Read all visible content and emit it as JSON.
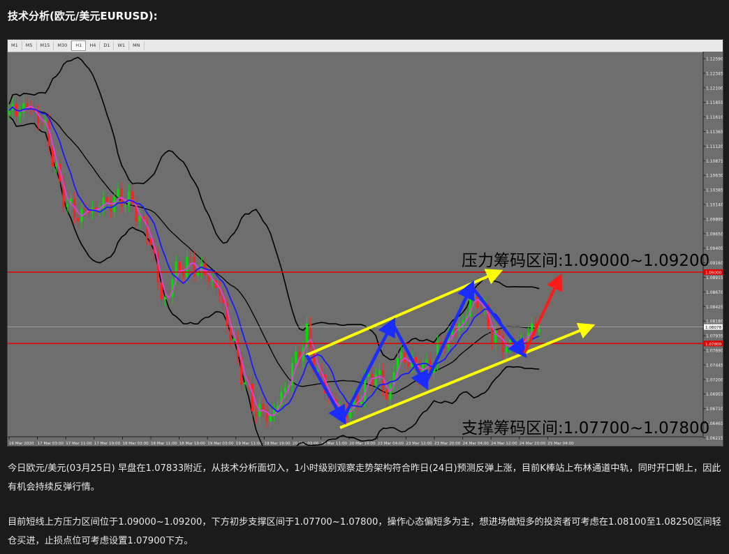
{
  "page": {
    "title": "技术分析(欧元/美元EURUSD):"
  },
  "toolbar": {
    "timeframes": [
      "M1",
      "M5",
      "M15",
      "M30",
      "H1",
      "H4",
      "D1",
      "W1",
      "MN"
    ],
    "active": "H1"
  },
  "chart": {
    "colors": {
      "background": "#6e6e6e",
      "bollinger": "#000000",
      "ma_fast": "#e040e0",
      "ma_slow": "#1a1aff",
      "candle_up": "#00e000",
      "candle_down": "#ff2020",
      "level_line": "#e00000",
      "channel": "#ffff00",
      "zigzag": "#1a2cff",
      "breakout_arrow": "#ff1a1a"
    },
    "y_ticks": [
      "1.12590",
      "1.12345",
      "1.12100",
      "1.11855",
      "1.11610",
      "1.11365",
      "1.11120",
      "1.10875",
      "1.10630",
      "1.10385",
      "1.10140",
      "1.09895",
      "1.09650",
      "1.09405",
      "1.09160",
      "1.08915",
      "1.08670",
      "1.08425",
      "1.08180",
      "1.07935",
      "1.07690",
      "1.07445",
      "1.07200",
      "1.06955",
      "1.06710",
      "1.06465",
      "1.06215"
    ],
    "current_price": "1.08078",
    "resistance_price": "1.09000",
    "support_price": "1.07800",
    "x_ticks": [
      "16 Mar 2020",
      "17 Mar 03:00",
      "17 Mar 11:00",
      "17 Mar 19:00",
      "18 Mar 03:00",
      "18 Mar 11:00",
      "18 Mar 19:00",
      "19 Mar 03:00",
      "19 Mar 11:00",
      "19 Mar 19:00",
      "20 Mar 03:00",
      "20 Mar 11:00",
      "20 Mar 19:00",
      "23 Mar 04:00",
      "23 Mar 12:00",
      "23 Mar 20:00",
      "24 Mar 04:00",
      "24 Mar 12:00",
      "24 Mar 20:00",
      "25 Mar 04:00"
    ],
    "resistance_label": "压力筹码区间:1.09000~1.09200",
    "support_label": "支撑筹码区间:1.07700~1.07800"
  },
  "text": {
    "para1": "今日欧元/美元(03月25日) 早盘在1.07833附近，从技术分析面切入，1小时级别观察走势架构符合昨日(24日)预测反弹上涨，目前K棒站上布林通道中轨，同时开口朝上，因此有机会持续反弹行情。",
    "para2": "目前短线上方压力区间位于1.09000~1.09200，下方初步支撑区间于1.07700~1.07800，操作心态偏短多为主，想进场做短多的投资者可考虑在1.08100至1.08250区间轻仓买进，止损点位可考虑设置1.07900下方。"
  }
}
